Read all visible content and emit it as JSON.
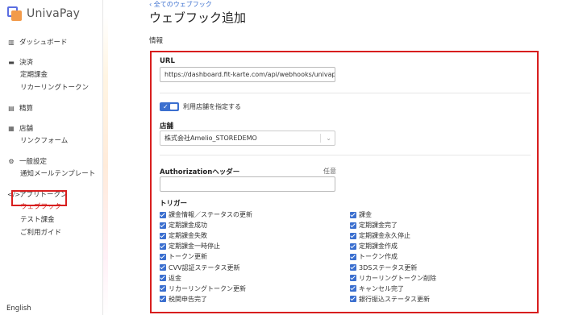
{
  "brand": {
    "name": "UnivaPay"
  },
  "sidebar": {
    "groups": [
      {
        "icon": "chart-icon",
        "label": "ダッシュボード",
        "items": []
      },
      {
        "icon": "card-icon",
        "label": "決済",
        "items": [
          "定期課金",
          "リカーリングトークン"
        ]
      },
      {
        "icon": "ledger-icon",
        "label": "精算",
        "items": []
      },
      {
        "icon": "store-icon",
        "label": "店舗",
        "items": [
          "リンクフォーム"
        ]
      },
      {
        "icon": "gear-icon",
        "label": "一般設定",
        "items": [
          "通知メールテンプレート"
        ]
      },
      {
        "icon": "code-icon",
        "label": "アプリトークン",
        "items": [
          "ウェブフック",
          "テスト課金",
          "ご利用ガイド"
        ]
      }
    ],
    "language": "English"
  },
  "breadcrumb": "‹ 全てのウェブフック",
  "page_title": "ウェブフック追加",
  "section_label": "情報",
  "form": {
    "url_label": "URL",
    "url_value": "https://dashboard.fit-karte.com/api/webhooks/univap",
    "toggle_label": "利用店舗を指定する",
    "store_label": "店舗",
    "store_value": "株式会社Amelio_STOREDEMO",
    "auth_label": "Authorizationヘッダー",
    "auth_optional": "任意",
    "trigger_label": "トリガー",
    "triggers_left": [
      "課金情報／ステータスの更新",
      "定期課金成功",
      "定期課金失敗",
      "定期課金一時停止",
      "トークン更新",
      "CVV認証ステータス更新",
      "返金",
      "リカーリングトークン更新",
      "税関申告完了"
    ],
    "triggers_right": [
      "課金",
      "定期課金完了",
      "定期課金永久停止",
      "定期課金作成",
      "トークン作成",
      "3DSステータス更新",
      "リカーリングトークン削除",
      "キャンセル完了",
      "銀行振込ステータス更新"
    ]
  }
}
